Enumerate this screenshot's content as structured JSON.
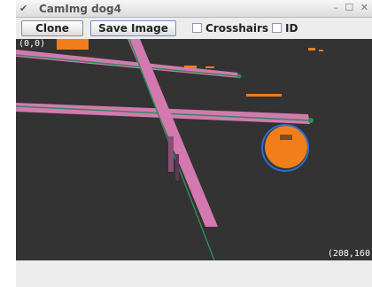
{
  "window": {
    "title": "CamImg dog4",
    "menu_glyph": "✔",
    "controls": "– ☐ ✕"
  },
  "toolbar": {
    "clone_label": "Clone",
    "save_label": "Save Image",
    "crosshairs_label": "Crosshairs",
    "id_label": "ID"
  },
  "image": {
    "origin_label": "(0,0)",
    "size_label": "(208,160)"
  },
  "colors": {
    "background": "#333333",
    "pink": "#d479b0",
    "orange": "#f07e1a",
    "line_green": "#2e8b57",
    "circle_blue": "#2a6fd6"
  }
}
